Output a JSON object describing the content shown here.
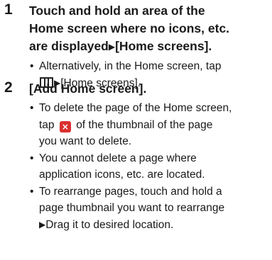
{
  "steps": [
    {
      "number": "1",
      "title_line1": "Touch and hold an area of the",
      "title_line2": "Home screen where no icons, etc.",
      "title_line3_pre": "are displayed",
      "title_line3_post": "[Home screens].",
      "bullets": [
        {
          "line1": "Alternatively, in the Home screen, tap",
          "line2_post": "[Home screens]."
        }
      ]
    },
    {
      "number": "2",
      "title": "[Add Home screen].",
      "bullets": [
        {
          "line1": "To delete the page of the Home screen,",
          "line2_pre": "tap",
          "line2_post": "of the thumbnail of the page",
          "line3": "you want to delete."
        },
        {
          "line1": "You cannot delete a page where",
          "line2": "application icons, etc. are located."
        },
        {
          "line1": "To rearrange pages, touch and hold a",
          "line2": "page thumbnail you want to rearrange",
          "line3_post": "Drag it to desired location."
        }
      ]
    }
  ],
  "glyphs": {
    "bullet": "•",
    "arrow": "▶",
    "delete_icon": "×"
  },
  "icons": {
    "apps_grid": "apps-grid-icon",
    "delete": "delete-icon"
  },
  "colors": {
    "delete_icon_bg": "#d9302e",
    "text": "#1a1a1a"
  }
}
